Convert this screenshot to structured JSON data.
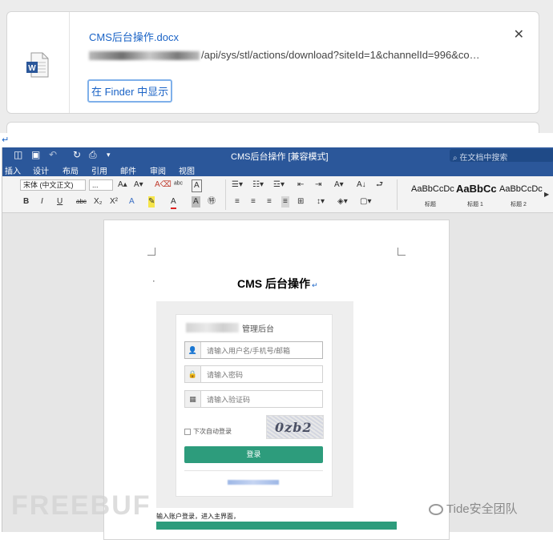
{
  "download_panel": {
    "filename": "CMS后台操作.docx",
    "url_tail": "/api/sys/stl/actions/download?siteId=1&channelId=996&co…",
    "show_in_finder": "在 Finder 中显示",
    "close_glyph": "✕",
    "file_icon": "word-document-icon",
    "return_mark": "↵"
  },
  "word": {
    "title": "CMS后台操作 [兼容模式]",
    "search_placeholder": "在文档中搜索",
    "menu": [
      "插入",
      "设计",
      "布局",
      "引用",
      "邮件",
      "审阅",
      "视图"
    ],
    "ribbon": {
      "font_name": "宋体 (中文正文)",
      "font_size": "...",
      "styles": [
        {
          "sample": "AaBbCcDc",
          "label": "标题"
        },
        {
          "sample": "AaBbCc",
          "label": "标题 1"
        },
        {
          "sample": "AaBbCcDc",
          "label": "标题 2"
        }
      ]
    },
    "document": {
      "heading": "CMS 后台操作",
      "heading_mark": "↵",
      "bullet": "·",
      "login": {
        "title_suffix": "管理后台",
        "username_placeholder": "请输入用户名/手机号/邮箱",
        "password_placeholder": "请输入密码",
        "captcha_placeholder": "请输入验证码",
        "captcha_text": "0zb2",
        "remember_label": "下次自动登录",
        "login_button": "登录",
        "accent_color": "#2d9c7c"
      },
      "after_text": "输入账户登录，进入主界面，"
    }
  },
  "watermarks": {
    "freebuf": "FREEBUF",
    "tide": "Tide安全团队"
  }
}
